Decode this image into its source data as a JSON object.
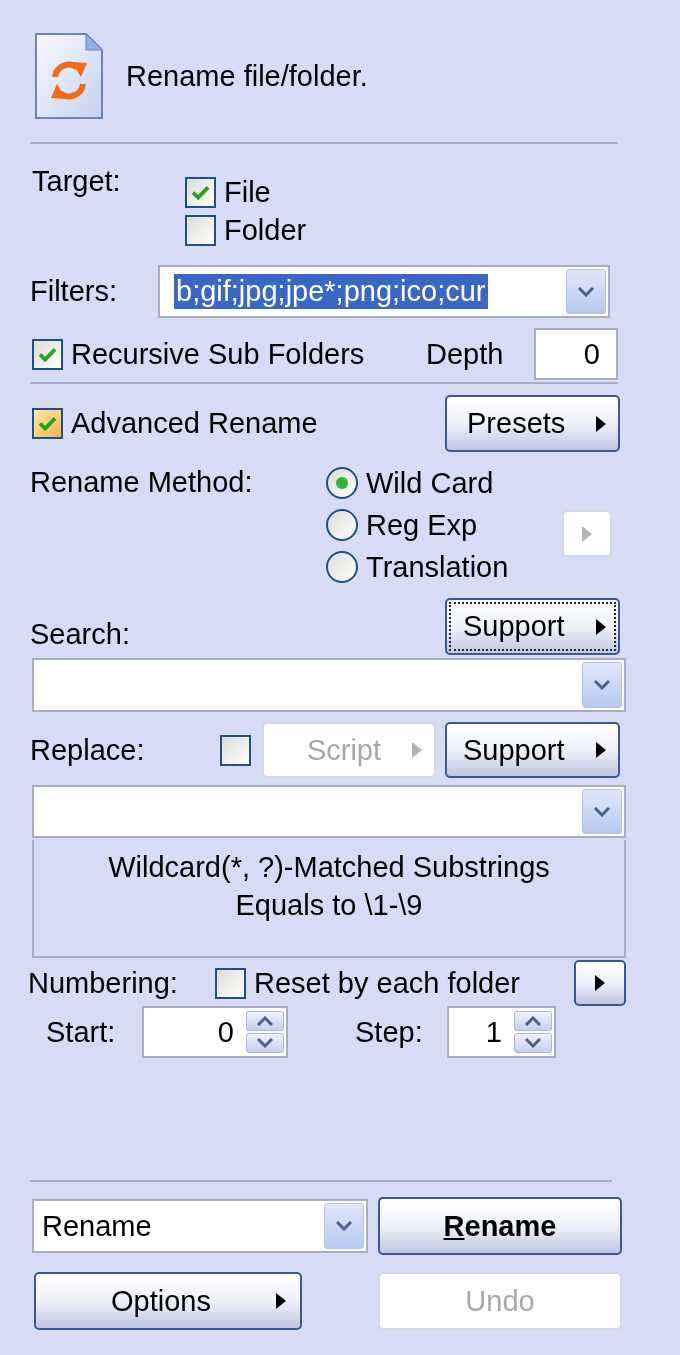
{
  "header": {
    "title": "Rename file/folder."
  },
  "target": {
    "label": "Target:",
    "options": [
      {
        "label": "File",
        "checked": true
      },
      {
        "label": "Folder",
        "checked": false
      }
    ]
  },
  "filters": {
    "label": "Filters:",
    "value": "b;gif;jpg;jpe*;png;ico;cur",
    "text_selected": true
  },
  "recursive": {
    "label": "Recursive Sub Folders",
    "checked": true
  },
  "depth": {
    "label": "Depth",
    "value": "0"
  },
  "advanced_rename": {
    "label": "Advanced Rename",
    "checked": true,
    "hovered": true
  },
  "presets_button": {
    "label": "Presets"
  },
  "rename_method": {
    "label": "Rename Method:",
    "options": [
      {
        "label": "Wild Card",
        "selected": true
      },
      {
        "label": "Reg Exp",
        "selected": false
      },
      {
        "label": "Translation",
        "selected": false
      }
    ],
    "more_button": {
      "disabled": true
    }
  },
  "search": {
    "label": "Search:",
    "support_button": {
      "label": "Support",
      "focused": true
    }
  },
  "replace": {
    "label": "Replace:",
    "script_checkbox": {
      "checked": false
    },
    "script_button": {
      "label": "Script",
      "disabled": true
    },
    "support_button": {
      "label": "Support",
      "focused": false
    }
  },
  "hint": {
    "lines": [
      "Wildcard(*, ?)-Matched Substrings",
      "Equals to \\1-\\9"
    ]
  },
  "numbering": {
    "label": "Numbering:",
    "reset": {
      "label": "Reset by each folder",
      "checked": false
    },
    "more_button": {
      "disabled": false
    },
    "start": {
      "label": "Start:",
      "value": "0"
    },
    "step": {
      "label": "Step:",
      "value": "1"
    }
  },
  "footer": {
    "action": {
      "value": "Rename"
    },
    "rename_button": {
      "label": "Rename",
      "mnemonic_underlined": true
    },
    "options_button": {
      "label": "Options"
    },
    "undo_button": {
      "label": "Undo",
      "disabled": true
    }
  }
}
